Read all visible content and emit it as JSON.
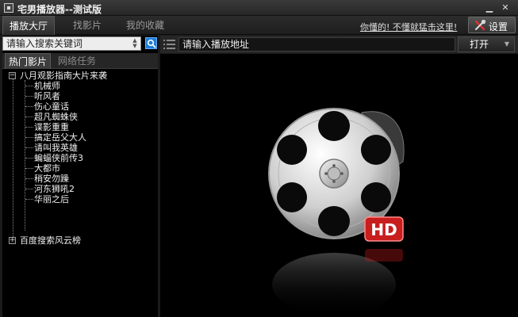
{
  "window": {
    "title": "宅男播放器--测试版",
    "minimize_glyph": "▁",
    "close_glyph": "✕"
  },
  "main_tabs": [
    {
      "label": "播放大厅",
      "active": true
    },
    {
      "label": "找影片",
      "active": false
    },
    {
      "label": "我的收藏",
      "active": false
    }
  ],
  "header": {
    "help_link": "你懂的! 不懂就猛击这里!",
    "settings_label": "设置",
    "settings_icon": "wrench-screwdriver-icon"
  },
  "sidebar": {
    "search": {
      "value": "请输入搜索关键词",
      "spin_up": "▲",
      "spin_down": "▼"
    },
    "subtabs": [
      {
        "label": "热门影片",
        "active": true
      },
      {
        "label": "网络任务",
        "active": false
      }
    ],
    "tree": [
      {
        "label": "八月观影指南大片来袭",
        "expanded": true,
        "expander": "−",
        "children": [
          "机械师",
          "听风者",
          "伤心童话",
          "超凡蜘蛛侠",
          "谍影重重",
          "搞定岳父大人",
          "请叫我英雄",
          "蝙蝠侠前传3",
          "大都市",
          "稍安勿躁",
          "河东狮吼2",
          "华丽之后"
        ]
      },
      {
        "label": "百度搜索风云榜",
        "expanded": false,
        "expander": "+",
        "children": []
      }
    ]
  },
  "player": {
    "url_input": {
      "value": "请输入播放地址"
    },
    "open_label": "打开",
    "open_arrow": "▼",
    "logo_icon": "film-reel-hd-icon",
    "badge": "HD",
    "colors": {
      "badge": "#c81e1e",
      "accent": "#1f7fd8"
    }
  }
}
